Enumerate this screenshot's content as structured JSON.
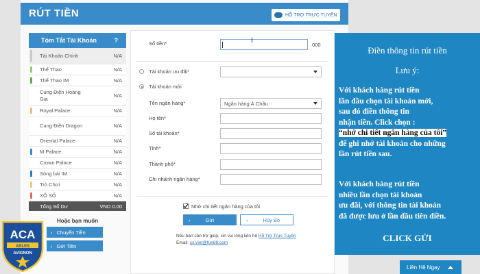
{
  "header": {
    "title": "RÚT TIỀN",
    "support_label": "HỖ TRỢ TRỰC TUYẾN"
  },
  "sidebar": {
    "heading": "Tóm Tắt Tài Khoản",
    "help": "?",
    "items": [
      {
        "label": "Tài Khoản Chính",
        "value": "N/A",
        "color": "#c9c9c9",
        "active": true
      },
      {
        "label": "Thể Thao",
        "value": "N/A",
        "color": "#8fcf6a"
      },
      {
        "label": "Thể Thao IM",
        "value": "N/A",
        "color": "#58b04a"
      },
      {
        "label": "Cung Điện Hoàng Gia",
        "value": "N/A",
        "color": "#ffffff"
      },
      {
        "label": "Royal Palace",
        "value": "N/A",
        "color": "#e7c17a"
      },
      {
        "label": "Cung Điện Dragon",
        "value": "N/A",
        "color": "#ffffff"
      },
      {
        "label": "Oriental Palace",
        "value": "N/A",
        "color": "#ffffff"
      },
      {
        "label": "M Palace",
        "value": "N/A",
        "color": "#3a8bc9"
      },
      {
        "label": "Crown Palace",
        "value": "N/A",
        "color": "#ffffff"
      },
      {
        "label": "Sòng bài IM",
        "value": "N/A",
        "color": "#2f7fbf"
      },
      {
        "label": "Trò Chơi",
        "value": "N/A",
        "color": "#e9d07a"
      },
      {
        "label": "XỔ SỐ",
        "value": "N/A",
        "color": "#e96a5a"
      }
    ],
    "total_label": "Tổng Số Dư",
    "total_value": "VND 0.00",
    "want_label": "Hoặc bạn muốn",
    "btn_transfer": "Chuyển Tiền",
    "btn_deposit": "Gửi Tiền"
  },
  "form": {
    "amount_label": "Số tiền*",
    "amount_value": "",
    "amount_suffix": ".000",
    "preferred_account_label": "Tài khoản ưu đãi*",
    "new_account_label": "Tài khoản mới",
    "bank_name_label": "Tên ngân hàng*",
    "bank_name_value": "Ngân hàng Á Châu",
    "fullname_label": "Họ tên*",
    "account_no_label": "Số tài khoản*",
    "province_label": "Tỉnh*",
    "city_label": "Thành phố*",
    "branch_label": "Chi nhánh ngân hàng*",
    "remember_label": "Nhớ chi tiết ngân hàng của tôi",
    "submit_label": "Gửi",
    "cancel_label": "Hủy Bỏ",
    "help_text": "Nếu bạn cần trợ giúp, xin vui lòng liên hệ",
    "help_link": "Hỗ Trợ Trực Tuyến",
    "email_label": "Email:",
    "email_value": "cs.viet@fun88.com"
  },
  "overlay": {
    "title": "Điền thông tin rút tiền",
    "note_title": "Lưu ý:",
    "para1_line1": "Với khách hàng rút tiền",
    "para1_line2": "lần đầu chọn tài khoản mới,",
    "para1_line3": "sau đó điền thông tin",
    "para1_line4": "nhận tiền. Click chọn :",
    "para1_highlight": "“nhớ chi tiết ngân hàng của tôi”",
    "para1_line5": "để ghi nhớ tài khoản cho những",
    "para1_line6": "lần rút tiền sau.",
    "para2_line1": "Với khách hàng rút tiền",
    "para2_line2": "nhiều lần chọn tài khoản",
    "para2_line3": "ưu đãi, với thông tin tài khoản",
    "para2_line4": "đã được lưu ở lần đầu tiên điền.",
    "cta": "CLICK GỬI"
  },
  "contact": {
    "label": "Liên Hệ Ngay"
  },
  "logo": {
    "text_top": "ACA",
    "text_mid": "ARLES",
    "text_bottom": "AVIGNON"
  },
  "colors": {
    "primary": "#3a8bc9",
    "overlay": "#1f86c4"
  }
}
